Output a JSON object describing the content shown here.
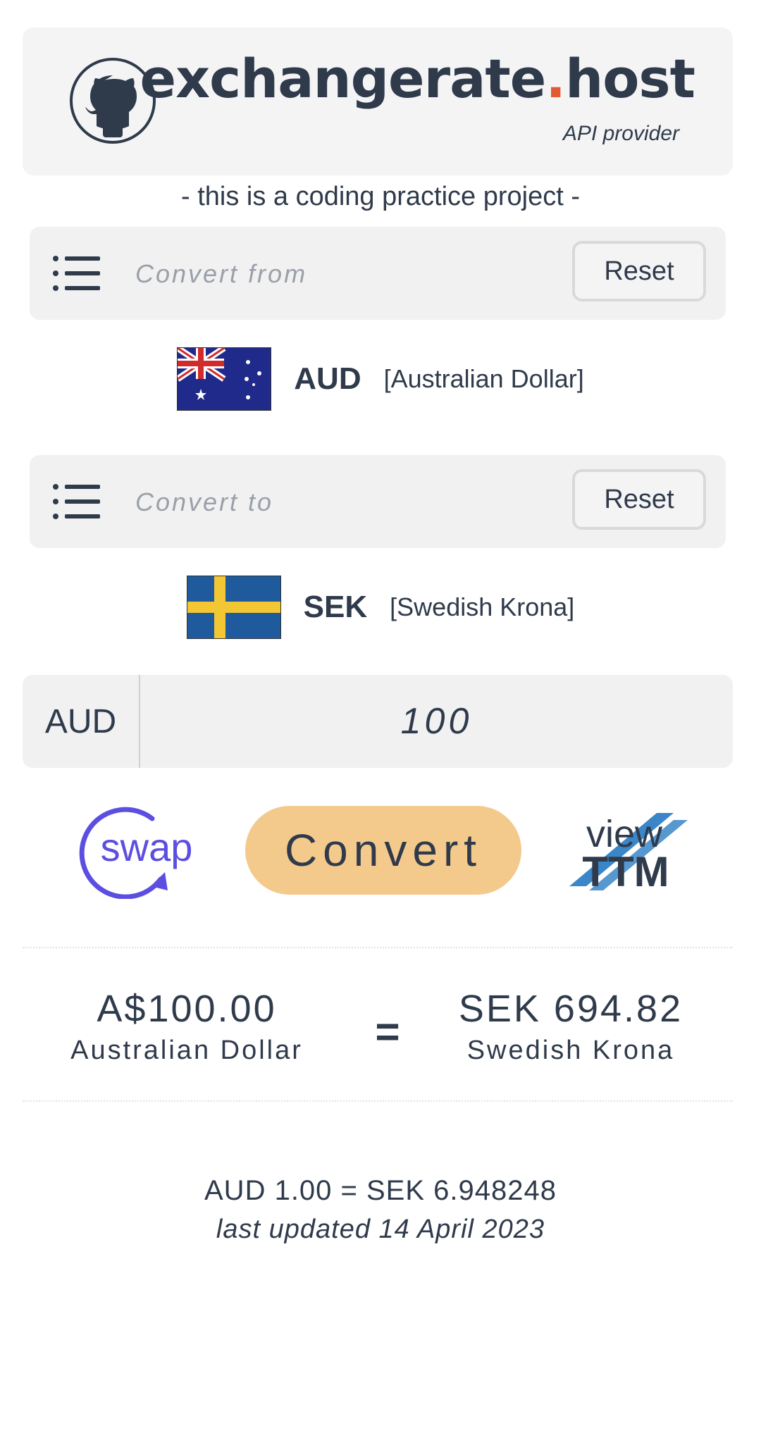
{
  "header": {
    "brand_main": "exchangerate",
    "brand_dot": ".",
    "brand_tld": "host",
    "brand_sub": "API provider",
    "logo_icon": "github-icon"
  },
  "tagline": "- this is a coding practice project -",
  "from_select": {
    "placeholder": "Convert from",
    "reset_label": "Reset",
    "icon": "list-icon"
  },
  "from_currency": {
    "code": "AUD",
    "name": "[Australian Dollar]",
    "flag": "australia-flag-icon"
  },
  "to_select": {
    "placeholder": "Convert to",
    "reset_label": "Reset",
    "icon": "list-icon"
  },
  "to_currency": {
    "code": "SEK",
    "name": "[Swedish Krona]",
    "flag": "sweden-flag-icon"
  },
  "amount": {
    "prefix": "AUD",
    "value": "100"
  },
  "actions": {
    "swap_label": "swap",
    "convert_label": "Convert",
    "ttm_top": "view",
    "ttm_bottom": "TTM"
  },
  "result": {
    "from_amount": "A$100.00",
    "from_name": "Australian Dollar",
    "equals": "=",
    "to_amount": "SEK 694.82",
    "to_name": "Swedish Krona"
  },
  "rate": {
    "line": "AUD 1.00 = SEK 6.948248",
    "updated": "last updated 14 April 2023"
  },
  "colors": {
    "text": "#2f3a4b",
    "accent_dot": "#e35a2f",
    "convert_bg": "#f4c98c",
    "swap": "#5b4ee0",
    "ttm_blue": "#3a86c8"
  }
}
